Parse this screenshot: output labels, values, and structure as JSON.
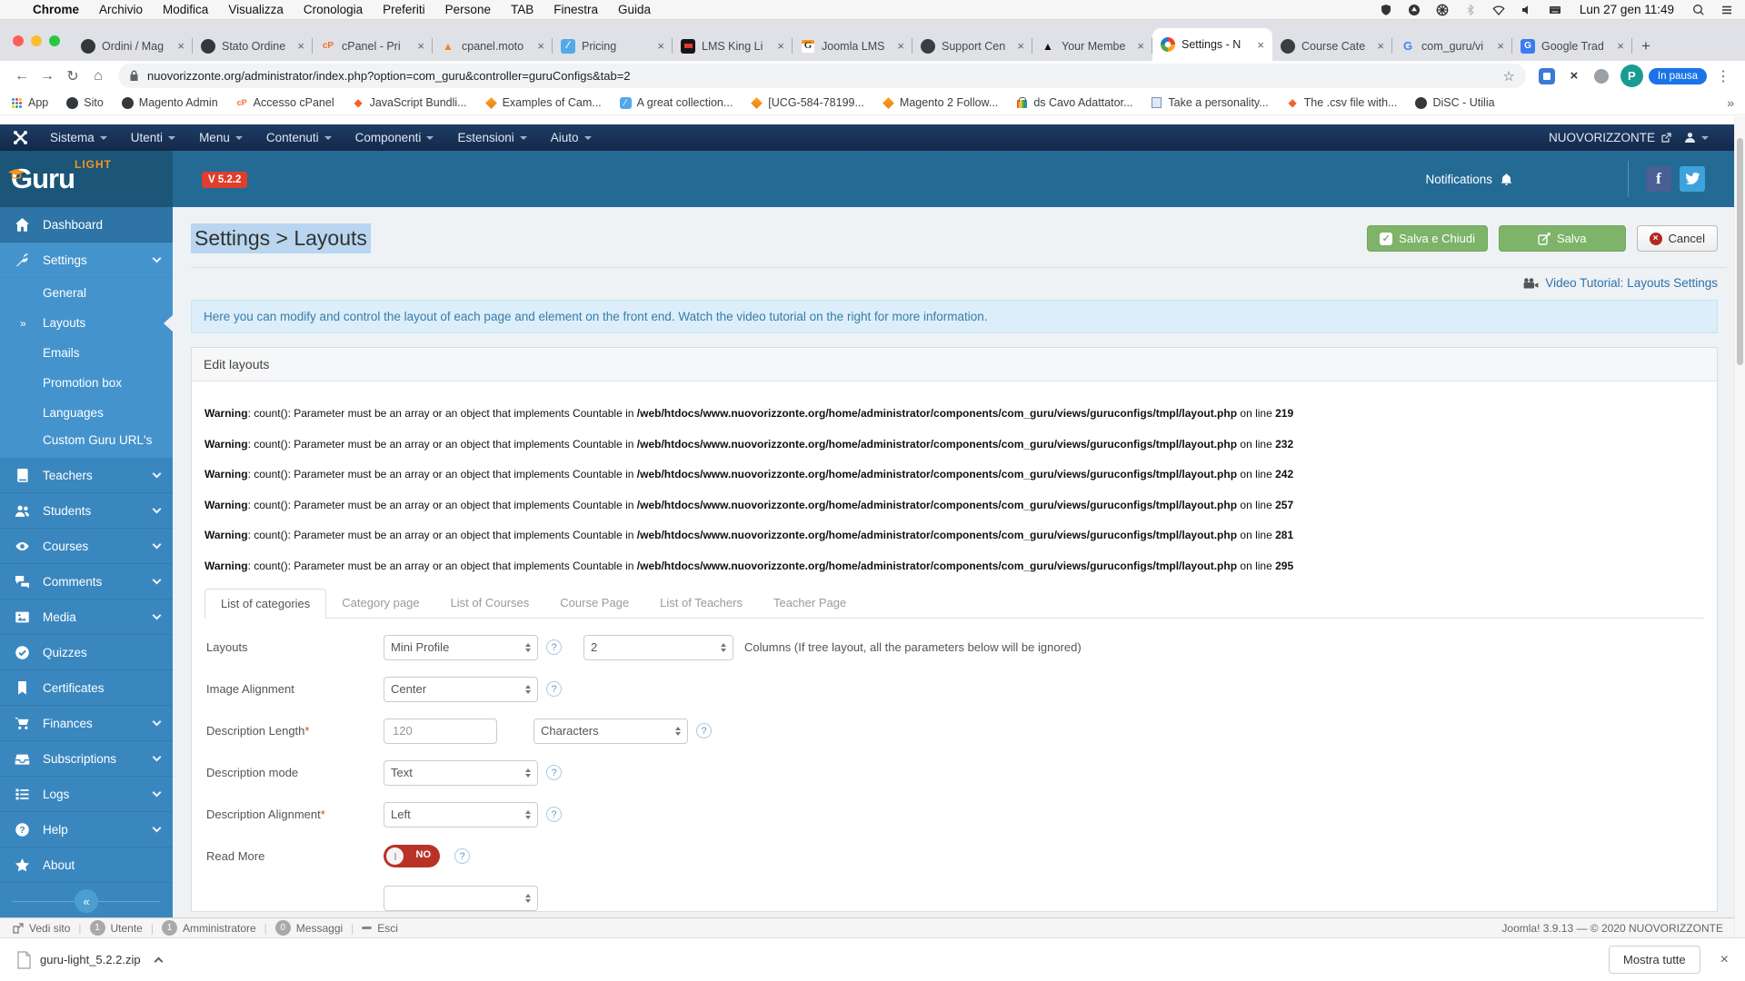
{
  "menubar": {
    "items": [
      "Chrome",
      "Archivio",
      "Modifica",
      "Visualizza",
      "Cronologia",
      "Preferiti",
      "Persone",
      "TAB",
      "Finestra",
      "Guida"
    ],
    "clock": "Lun 27 gen 11:49"
  },
  "browser": {
    "tabs": [
      {
        "label": "Ordini / Mag"
      },
      {
        "label": "Stato Ordine"
      },
      {
        "label": "cPanel - Pri"
      },
      {
        "label": "cpanel.moto"
      },
      {
        "label": "Pricing"
      },
      {
        "label": "LMS King Li"
      },
      {
        "label": "Joomla LMS"
      },
      {
        "label": "Support Cen"
      },
      {
        "label": "Your Membe"
      },
      {
        "label": "Settings - N"
      },
      {
        "label": "Course Cate"
      },
      {
        "label": "com_guru/vi"
      },
      {
        "label": "Google Trad"
      }
    ],
    "url": "nuovorizzonte.org/administrator/index.php?option=com_guru&controller=guruConfigs&tab=2",
    "avatar": "P",
    "profile_status": "In pausa",
    "bookmarks": [
      "App",
      "Sito",
      "Magento Admin",
      "Accesso cPanel",
      "JavaScript Bundli...",
      "Examples of Cam...",
      "A great collection...",
      "[UCG-584-78199...",
      "Magento 2 Follow...",
      "ds Cavo Adattator...",
      "Take a personality...",
      "The .csv file with...",
      "DiSC - Utilia"
    ]
  },
  "joomla": {
    "nav": [
      "Sistema",
      "Utenti",
      "Menu",
      "Contenuti",
      "Componenti",
      "Estensioni",
      "Aiuto"
    ],
    "site_name": "NUOVORIZZONTE"
  },
  "guru": {
    "brand": "Guru",
    "light": "LIGHT",
    "version": "V 5.2.2",
    "notifications": "Notifications"
  },
  "sidebar": {
    "dashboard": "Dashboard",
    "settings": "Settings",
    "settings_children": [
      "General",
      "Layouts",
      "Emails",
      "Promotion box",
      "Languages",
      "Custom Guru URL's"
    ],
    "items": [
      "Teachers",
      "Students",
      "Courses",
      "Comments",
      "Media",
      "Quizzes",
      "Certificates",
      "Finances",
      "Subscriptions",
      "Logs",
      "Help",
      "About"
    ]
  },
  "page": {
    "title": "Settings > Layouts",
    "save_close": "Salva e Chiudi",
    "save": "Salva",
    "cancel": "Cancel",
    "video_tutorial": "Video Tutorial: Layouts Settings",
    "info": "Here you can modify and control the layout of each page and element on the front end. Watch the video tutorial on the right for more information.",
    "panel_title": "Edit layouts"
  },
  "warnings": {
    "label": "Warning",
    "message": ": count(): Parameter must be an array or an object that implements Countable in ",
    "path": "/web/htdocs/www.nuovorizzonte.org/home/administrator/components/com_guru/views/guruconfigs/tmpl/layout.php",
    "on_line": " on line ",
    "lines": [
      "219",
      "232",
      "242",
      "257",
      "281",
      "295"
    ]
  },
  "form": {
    "tabs": [
      "List of categories",
      "Category page",
      "List of Courses",
      "Course Page",
      "List of Teachers",
      "Teacher Page"
    ],
    "layouts": {
      "label": "Layouts",
      "value": "Mini Profile",
      "columns": "2",
      "note": "Columns (If tree layout, all the parameters below will be ignored)"
    },
    "image_alignment": {
      "label": "Image Alignment",
      "value": "Center"
    },
    "description_length": {
      "label": "Description Length",
      "value": "120",
      "unit": "Characters"
    },
    "description_mode": {
      "label": "Description mode",
      "value": "Text"
    },
    "description_alignment": {
      "label": "Description Alignment",
      "value": "Left"
    },
    "read_more": {
      "label": "Read More",
      "value": "NO"
    }
  },
  "statusbar": {
    "view_site": "Vedi sito",
    "counters": [
      {
        "count": "1",
        "label": "Utente"
      },
      {
        "count": "1",
        "label": "Amministratore"
      },
      {
        "count": "0",
        "label": "Messaggi"
      }
    ],
    "logout": "Esci",
    "meta": "Joomla! 3.9.13 — © 2020 NUOVORIZZONTE"
  },
  "shelf": {
    "filename": "guru-light_5.2.2.zip",
    "show_all": "Mostra tutte"
  }
}
